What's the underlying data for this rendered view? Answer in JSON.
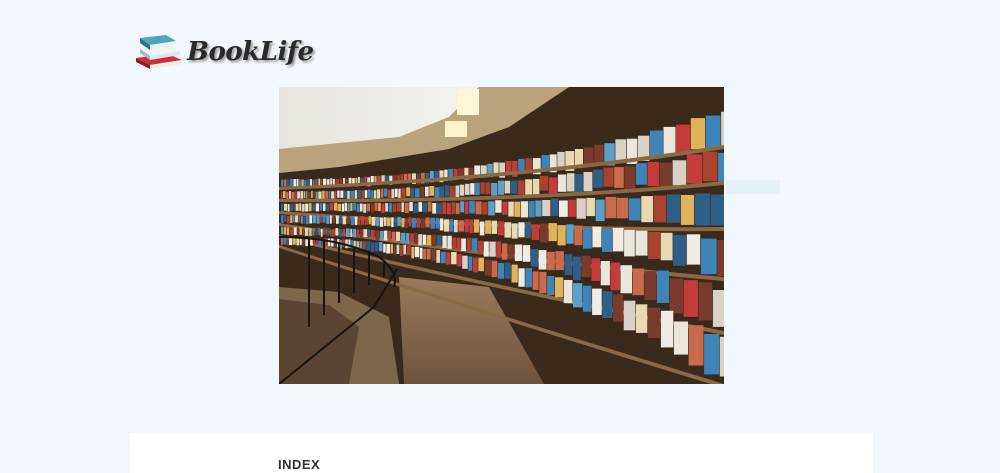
{
  "site": {
    "brand_name": "BookLife",
    "logo_icon": "book-stack-icon"
  },
  "hero": {
    "image_subject": "library-bookshelves-photo"
  },
  "index": {
    "title": "INDEX"
  }
}
